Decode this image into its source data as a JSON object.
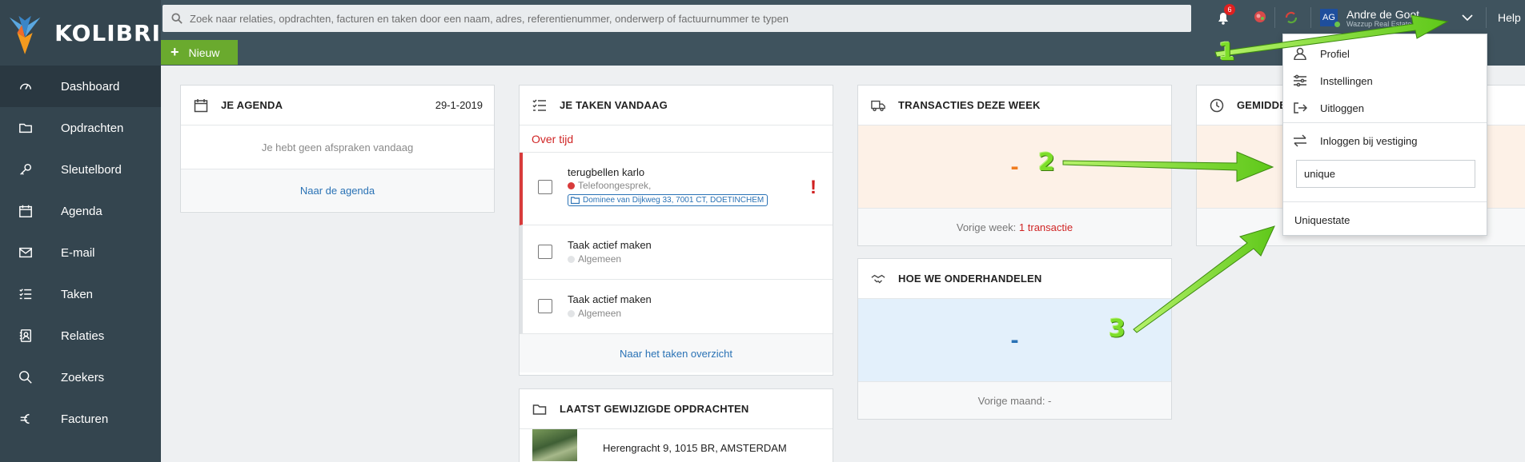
{
  "app": {
    "name": "KOLIBRI"
  },
  "search": {
    "placeholder": "Zoek naar relaties, opdrachten, facturen en taken door een naam, adres, referentienummer, onderwerp of factuurnummer te typen"
  },
  "toolbar": {
    "new_label": "Nieuw",
    "notification_count": "6",
    "help_label": "Help"
  },
  "user": {
    "initials": "AG",
    "name": "Andre de Goot",
    "company": "Wazzup Real Estate"
  },
  "sidebar": {
    "items": [
      {
        "label": "Dashboard",
        "icon": "gauge-icon"
      },
      {
        "label": "Opdrachten",
        "icon": "folder-icon"
      },
      {
        "label": "Sleutelbord",
        "icon": "key-icon"
      },
      {
        "label": "Agenda",
        "icon": "calendar-icon"
      },
      {
        "label": "E-mail",
        "icon": "mail-icon"
      },
      {
        "label": "Taken",
        "icon": "tasks-icon"
      },
      {
        "label": "Relaties",
        "icon": "contacts-icon"
      },
      {
        "label": "Zoekers",
        "icon": "search-icon"
      },
      {
        "label": "Facturen",
        "icon": "euro-icon"
      }
    ]
  },
  "agenda": {
    "title": "JE AGENDA",
    "date": "29-1-2019",
    "empty": "Je hebt geen afspraken vandaag",
    "link": "Naar de agenda"
  },
  "tasks": {
    "title": "JE TAKEN VANDAAG",
    "overdue_label": "Over tijd",
    "items": [
      {
        "title": "terugbellen karlo",
        "type": "Telefoongesprek,",
        "address": "Dominee van Dijkweg 33, 7001 CT, DOETINCHEM"
      },
      {
        "title": "Taak actief maken",
        "type": "Algemeen"
      },
      {
        "title": "Taak actief maken",
        "type": "Algemeen"
      }
    ],
    "link": "Naar het taken overzicht"
  },
  "recent": {
    "title": "LAATST GEWIJZIGDE OPDRACHTEN",
    "address": "Herengracht 9, 1015 BR, AMSTERDAM"
  },
  "transactions": {
    "title": "TRANSACTIES DEZE WEEK",
    "value": "-",
    "footer_prefix": "Vorige week:",
    "footer_value": "1 transactie"
  },
  "negotiation": {
    "title": "HOE WE ONDERHANDELEN",
    "value": "-",
    "footer": "Vorige maand: -"
  },
  "average": {
    "title": "GEMIDDE"
  },
  "dropdown": {
    "profile": "Profiel",
    "settings": "Instellingen",
    "logout": "Uitloggen",
    "branch_login": "Inloggen bij vestiging",
    "branch_input": "unique",
    "branch_result": "Uniquestate"
  },
  "annotations": [
    "1",
    "2",
    "3"
  ],
  "colors": {
    "sidebar": "#34454f",
    "topbar": "#3f535e",
    "accent_green": "#6aaa2e",
    "arrow_green": "#7dde2a",
    "orange": "#f07c1f",
    "blue": "#2a72b5",
    "red": "#d02525"
  }
}
